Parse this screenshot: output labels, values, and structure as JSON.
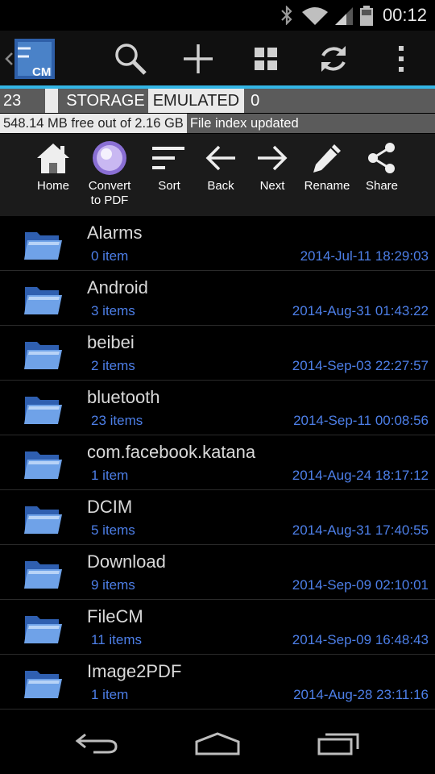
{
  "status": {
    "time": "00:12"
  },
  "action_bar": {
    "logo_text": "CM",
    "buttons": [
      "search-icon",
      "add-icon",
      "grid-icon",
      "refresh-icon",
      "overflow-menu-icon"
    ]
  },
  "path": {
    "seg1": "23",
    "seg2": "STORAGE",
    "seg3": "EMULATED",
    "seg4": "0"
  },
  "info": {
    "free_space": "548.14 MB free out of 2.16 GB",
    "status": "File index updated"
  },
  "toolbar": {
    "home": "Home",
    "convert_line1": "Convert",
    "convert_line2": "to PDF",
    "sort": "Sort",
    "back": "Back",
    "next": "Next",
    "rename": "Rename",
    "share": "Share"
  },
  "files": [
    {
      "name": "Alarms",
      "count": "0 item",
      "date": "2014-Jul-11 18:29:03"
    },
    {
      "name": "Android",
      "count": "3 items",
      "date": "2014-Aug-31 01:43:22"
    },
    {
      "name": "beibei",
      "count": "2 items",
      "date": "2014-Sep-03 22:27:57"
    },
    {
      "name": "bluetooth",
      "count": "23 items",
      "date": "2014-Sep-11 00:08:56"
    },
    {
      "name": "com.facebook.katana",
      "count": "1 item",
      "date": "2014-Aug-24 18:17:12"
    },
    {
      "name": "DCIM",
      "count": "5 items",
      "date": "2014-Aug-31 17:40:55"
    },
    {
      "name": "Download",
      "count": "9 items",
      "date": "2014-Sep-09 02:10:01"
    },
    {
      "name": "FileCM",
      "count": "11 items",
      "date": "2014-Sep-09 16:48:43"
    },
    {
      "name": "Image2PDF",
      "count": "1 item",
      "date": "2014-Aug-28 23:11:16"
    }
  ],
  "colors": {
    "accent": "#33b5e5",
    "meta_text": "#4d7fe8"
  }
}
